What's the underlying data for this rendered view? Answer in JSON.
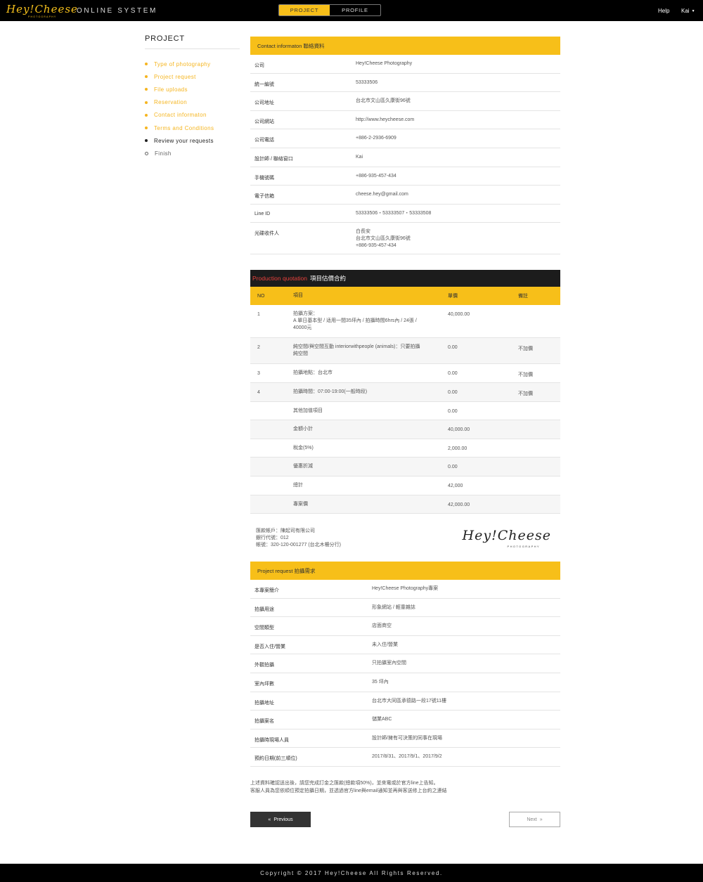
{
  "header": {
    "logo_text": "Hey!Cheese",
    "logo_subtext": "PHOTOGRAPHY",
    "system_title": "ONLINE SYSTEM",
    "tabs": [
      {
        "label": "PROJECT",
        "active": true
      },
      {
        "label": "PROFILE",
        "active": false
      }
    ],
    "help_label": "Help",
    "user_name": "Kai"
  },
  "sidebar": {
    "title": "PROJECT",
    "steps": [
      {
        "label": "Type of photography",
        "state": "done"
      },
      {
        "label": "Project request",
        "state": "done"
      },
      {
        "label": "File uploads",
        "state": "done"
      },
      {
        "label": "Reservation",
        "state": "done"
      },
      {
        "label": "Contact informaton",
        "state": "done"
      },
      {
        "label": "Terms and Conditions",
        "state": "done"
      },
      {
        "label": "Review your requests",
        "state": "current"
      },
      {
        "label": "Finish",
        "state": "todo"
      }
    ]
  },
  "contact": {
    "heading": "Contact informaton 聯絡資料",
    "rows": [
      {
        "label": "公司",
        "value": "Hey!Cheese Photography"
      },
      {
        "label": "統一編號",
        "value": "53333506"
      },
      {
        "label": "公司地址",
        "value": "台北市文山區久康街96號"
      },
      {
        "label": "公司網站",
        "value": "http://www.heycheese.com"
      },
      {
        "label": "公司電話",
        "value": "+886-2-2936-6909"
      },
      {
        "label": "設計師 / 聯絡窗口",
        "value": "Kai"
      },
      {
        "label": "手機號碼",
        "value": "+886-935-457-434"
      },
      {
        "label": "電子信箱",
        "value": "cheese.hey@gmail.com"
      },
      {
        "label": "Line ID",
        "value": "53333506・53333507・53333508"
      }
    ],
    "disc_label": "光碟收件人",
    "disc_lines": [
      "白長安",
      "台北市文山區久康街96號",
      "+886-935-457-434"
    ]
  },
  "quotation": {
    "heading_en": "Production quotation",
    "heading_zh": "項目估價合約",
    "columns": {
      "no": "NO",
      "item": "項目",
      "price": "單價",
      "note": "備註"
    },
    "rows": [
      {
        "no": "1",
        "item_lines": [
          "拍攝方案：",
          "A 單日基本型 / 适用一間35坪內 / 拍攝時間6hrs內 / 24張 /",
          "40000元"
        ],
        "price": "40,000.00",
        "note": ""
      },
      {
        "no": "2",
        "item_lines": [
          "純空間/與空間互動 interiorwithpeople (animals)：只要拍攝",
          "純空間"
        ],
        "price": "0.00",
        "note": "不加價"
      },
      {
        "no": "3",
        "item_lines": [
          "拍攝地點：台北市"
        ],
        "price": "0.00",
        "note": "不加價"
      },
      {
        "no": "4",
        "item_lines": [
          "拍攝時間：07:00-19:00(一般時段)"
        ],
        "price": "0.00",
        "note": "不加價"
      },
      {
        "no": "",
        "item_lines": [
          "其他加值項目"
        ],
        "price": "0.00",
        "note": ""
      },
      {
        "no": "",
        "item_lines": [
          "金額小計"
        ],
        "price": "40,000.00",
        "note": ""
      },
      {
        "no": "",
        "item_lines": [
          "稅金(5%)"
        ],
        "price": "2,000.00",
        "note": ""
      },
      {
        "no": "",
        "item_lines": [
          "優惠折減"
        ],
        "price": "0.00",
        "note": ""
      },
      {
        "no": "",
        "item_lines": [
          "總計"
        ],
        "price": "42,000",
        "note": ""
      },
      {
        "no": "",
        "item_lines": [
          "專案價"
        ],
        "price": "42,000.00",
        "note": ""
      }
    ],
    "bank_lines": [
      "匯款帳戶：陳起司有限公司",
      "銀行代號：012",
      "帳號：320-120-001277 (台北木柵分行)"
    ],
    "signature_text": "Hey!Cheese",
    "signature_sub": "PHOTOGRAPHY"
  },
  "request": {
    "heading": "Project request 拍攝需求",
    "rows": [
      {
        "label": "本專案簡介",
        "value": "Hey!Cheese Photography專案"
      },
      {
        "label": "拍攝用途",
        "value": "形象網站 / 輕童雜誌"
      },
      {
        "label": "空間類型",
        "value": "店面商空"
      },
      {
        "label": "是否入住/營業",
        "value": "未入住/營業"
      },
      {
        "label": "外觀拍攝",
        "value": "只拍攝室內空間"
      },
      {
        "label": "室內坪數",
        "value": "35 坪內"
      },
      {
        "label": "拍攝地址",
        "value": "台北市大同區承德路一段17號11樓"
      },
      {
        "label": "拍攝案名",
        "value": "儲業ABC"
      },
      {
        "label": "拍攝時現場人員",
        "value": "設計師/擁有可決策的同事在現場"
      },
      {
        "label": "預約日期(前三順位)",
        "value": "2017/8/31、2017/9/1、2017/9/2"
      }
    ]
  },
  "note_lines": [
    "上述資料確認送出後，請您完成訂金之匯款(總款項50%)，並來電或於官方line上告知。",
    "客服人員為您依順位預定拍攝日期，並透過官方line與email通知並再與客送修上台約之連結"
  ],
  "buttons": {
    "previous": "Previous",
    "next": "Next"
  },
  "footer": {
    "text": "Copyright © 2017 Hey!Cheese All Rights Reserved."
  },
  "colors": {
    "accent": "#f7bf19",
    "dark": "#000000",
    "quote_red": "#e8413c"
  }
}
